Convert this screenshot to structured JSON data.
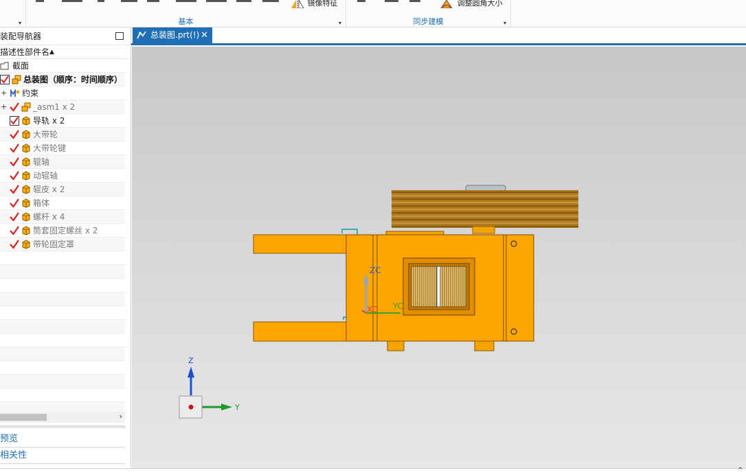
{
  "ribbon": {
    "group_basic_label": "基本",
    "group_sync_label": "同步建模",
    "btn_mirror_feature": "镜像特征",
    "btn_resize_fillet": "调整圆角大小",
    "expand_glyph": "▾"
  },
  "navigator": {
    "title": "装配导航器",
    "column_header": "描述性部件名",
    "sort_glyph": "▲",
    "items": [
      {
        "label": "截面",
        "style": "normal",
        "check": "none",
        "icon": "section-folder-icon"
      },
      {
        "label": "总装图（顺序：时间顺序）",
        "style": "bold",
        "check": "box",
        "icon": "assembly-icon"
      },
      {
        "label": "约束",
        "style": "normal",
        "check": "none",
        "icon": "constraint-icon"
      },
      {
        "label": "_asm1 x 2",
        "style": "dim",
        "check": "tick",
        "icon": "assembly-icon"
      },
      {
        "label": "导轨 x 2",
        "style": "normal",
        "check": "box",
        "icon": "part-icon"
      },
      {
        "label": "大带轮",
        "style": "dim",
        "check": "tick",
        "icon": "part-icon"
      },
      {
        "label": "大带轮键",
        "style": "dim",
        "check": "tick",
        "icon": "part-icon"
      },
      {
        "label": "辊轴",
        "style": "dim",
        "check": "tick",
        "icon": "part-icon"
      },
      {
        "label": "动辊轴",
        "style": "dim",
        "check": "tick",
        "icon": "part-icon"
      },
      {
        "label": "辊皮 x 2",
        "style": "dim",
        "check": "tick",
        "icon": "part-icon"
      },
      {
        "label": "箱体",
        "style": "dim",
        "check": "tick",
        "icon": "part-icon"
      },
      {
        "label": "螺杆 x 4",
        "style": "dim",
        "check": "tick",
        "icon": "part-icon"
      },
      {
        "label": "筒套固定螺丝 x 2",
        "style": "dim",
        "check": "tick",
        "icon": "part-icon"
      },
      {
        "label": "带轮固定罩",
        "style": "dim",
        "check": "tick",
        "icon": "part-icon"
      }
    ],
    "preview_label": "预览",
    "dependency_label": "相关性",
    "scroll_right_glyph": "›"
  },
  "tab": {
    "label": "总装图.prt(!)",
    "close_glyph": "✕"
  },
  "viewport": {
    "csys_zc": "ZC",
    "csys_yc": "YC",
    "csys_xc": "XC",
    "triad_z": "Z",
    "triad_y": "Y"
  },
  "colors": {
    "accent": "#1f6fb5",
    "part_orange": "#ffa500",
    "check_red": "#d42020"
  },
  "status": {
    "collapse_glyph": "^"
  }
}
